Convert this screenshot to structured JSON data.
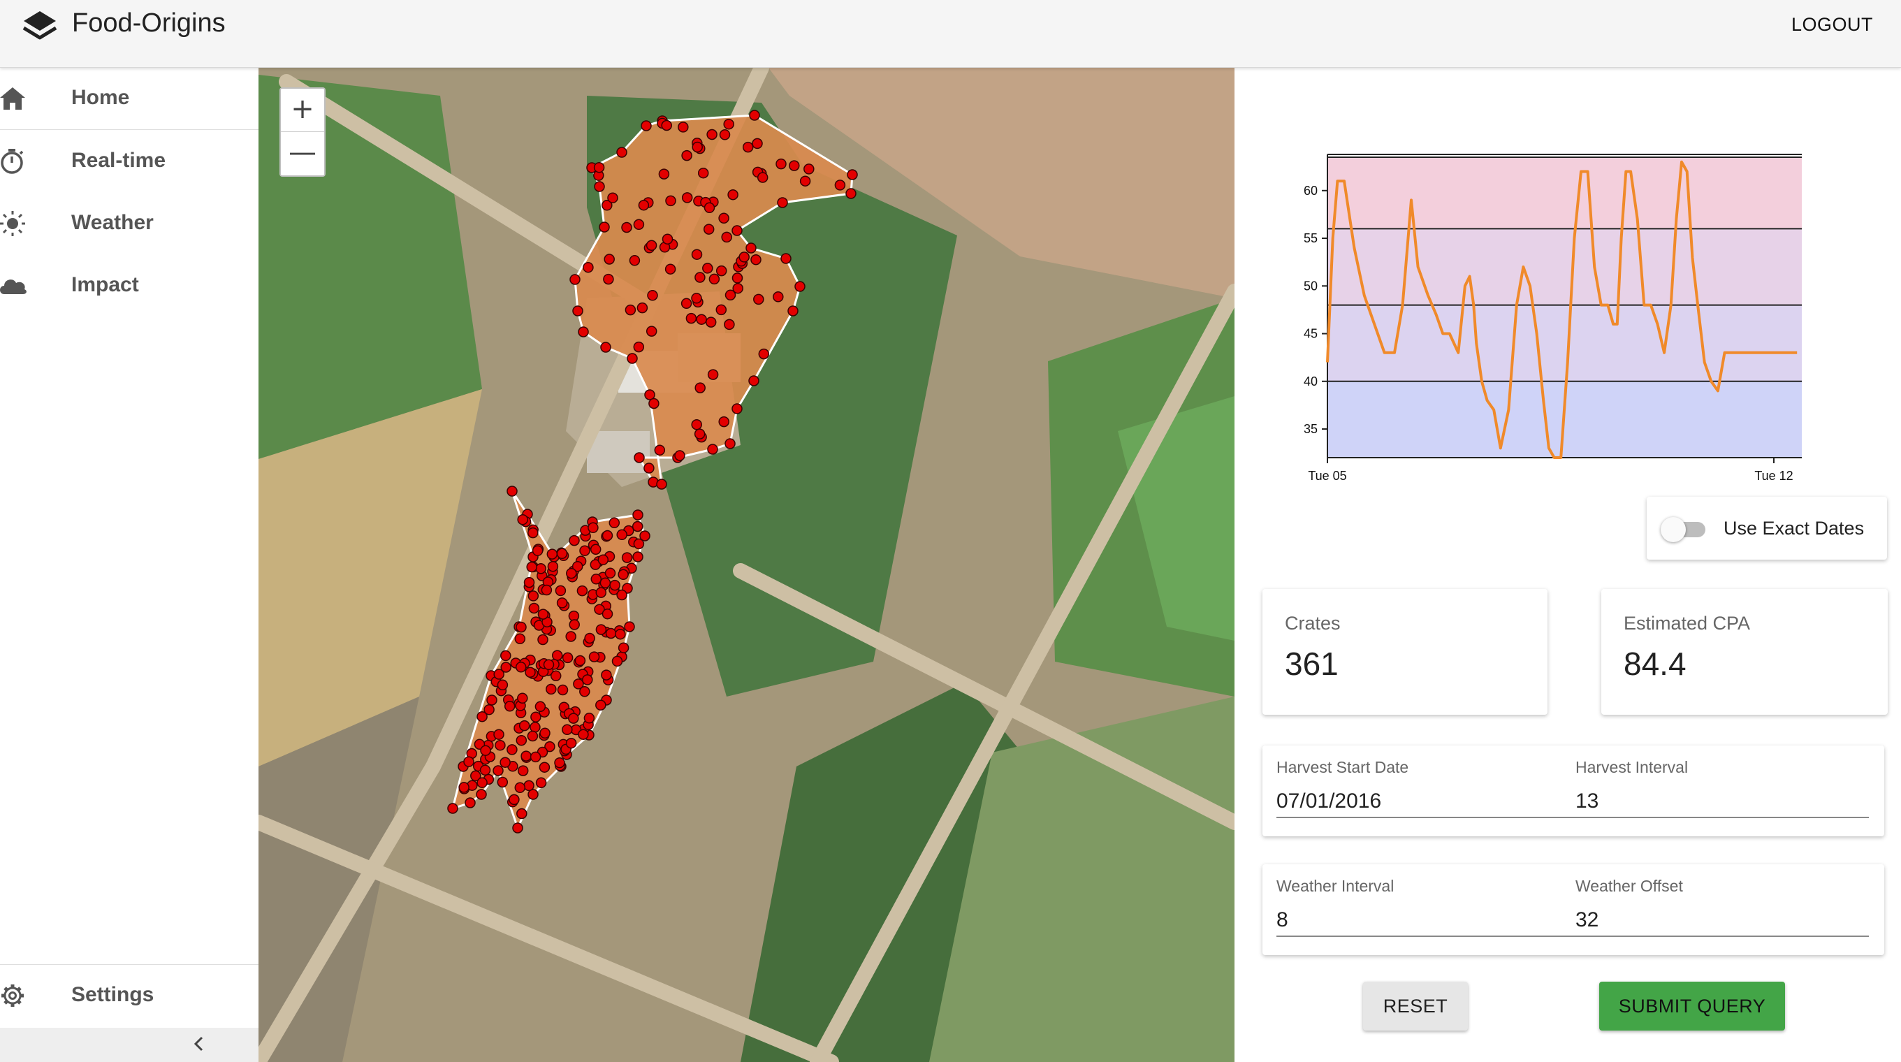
{
  "app": {
    "title": "Food-Origins",
    "logout_label": "LOGOUT",
    "logo_icon": "layers-icon"
  },
  "sidebar": {
    "items": [
      {
        "label": "Home",
        "icon": "home-icon"
      },
      {
        "label": "Real-time",
        "icon": "stopwatch-icon"
      },
      {
        "label": "Weather",
        "icon": "sun-icon"
      },
      {
        "label": "Impact",
        "icon": "cloud-icon"
      }
    ],
    "settings": {
      "label": "Settings",
      "icon": "gear-icon"
    },
    "collapse_icon": "chevron-left-icon"
  },
  "map": {
    "zoom_in": "+",
    "zoom_out": "—",
    "polygon_color": "#d98a4e",
    "point_color": "#e30000",
    "upper_field_points": 118,
    "lower_field_points": 225
  },
  "chart_data": {
    "type": "line",
    "x_ticks": [
      "Tue 05",
      "Tue 12"
    ],
    "y_ticks": [
      35,
      40,
      45,
      50,
      55,
      60
    ],
    "ylim": [
      32,
      63.5
    ],
    "bands": [
      {
        "from": 56,
        "to": 63.5,
        "color": "#f3cfdc"
      },
      {
        "from": 48,
        "to": 56,
        "color": "#e7d2e8"
      },
      {
        "from": 40,
        "to": 48,
        "color": "#dcd3f0"
      },
      {
        "from": 32,
        "to": 40,
        "color": "#cfd3f8"
      }
    ],
    "threshold_lines": [
      40,
      48,
      56,
      63.5
    ],
    "series": [
      {
        "color": "#f08a2a",
        "x": [
          0.0,
          0.08,
          0.15,
          0.25,
          0.4,
          0.55,
          0.7,
          0.85,
          1.0,
          1.12,
          1.25,
          1.35,
          1.5,
          1.62,
          1.72,
          1.82,
          1.95,
          2.05,
          2.12,
          2.18,
          2.22,
          2.3,
          2.38,
          2.48,
          2.58,
          2.7,
          2.82,
          2.92,
          3.02,
          3.12,
          3.22,
          3.3,
          3.38,
          3.48,
          3.58,
          3.68,
          3.78,
          3.88,
          3.98,
          4.08,
          4.18,
          4.26,
          4.32,
          4.38,
          4.45,
          4.52,
          4.62,
          4.72,
          4.82,
          4.92,
          5.02,
          5.12,
          5.2,
          5.28,
          5.36,
          5.44,
          5.52,
          5.62,
          5.72,
          5.82,
          5.92,
          6.02,
          6.1,
          6.18,
          6.26,
          6.35,
          6.45,
          6.55,
          6.65,
          6.75,
          6.85,
          6.92,
          7.0
        ],
        "y": [
          42,
          55,
          61,
          61,
          54,
          49,
          46,
          43,
          43,
          48,
          59,
          52,
          49,
          47,
          45,
          45,
          43,
          50,
          51,
          48,
          44,
          40,
          38,
          37,
          33,
          37,
          48,
          52,
          50,
          45,
          38,
          33,
          32,
          32,
          42,
          55,
          62,
          62,
          52,
          48,
          48,
          46,
          46,
          55,
          62,
          62,
          57,
          48,
          48,
          46,
          43,
          48,
          57,
          63,
          62,
          53,
          48,
          42,
          40,
          39,
          43,
          43,
          43,
          43,
          43,
          43,
          43,
          43,
          43,
          43,
          43,
          43,
          43
        ]
      }
    ]
  },
  "controls": {
    "exact_dates_label": "Use Exact Dates",
    "exact_dates_on": false
  },
  "stats": {
    "crates": {
      "label": "Crates",
      "value": "361"
    },
    "cpa": {
      "label": "Estimated CPA",
      "value": "84.4"
    }
  },
  "form": {
    "harvest_start_label": "Harvest Start Date",
    "harvest_start_value": "07/01/2016",
    "harvest_interval_label": "Harvest Interval",
    "harvest_interval_value": "13",
    "weather_interval_label": "Weather Interval",
    "weather_interval_value": "8",
    "weather_offset_label": "Weather Offset",
    "weather_offset_value": "32"
  },
  "buttons": {
    "reset": "RESET",
    "submit": "SUBMIT QUERY"
  }
}
